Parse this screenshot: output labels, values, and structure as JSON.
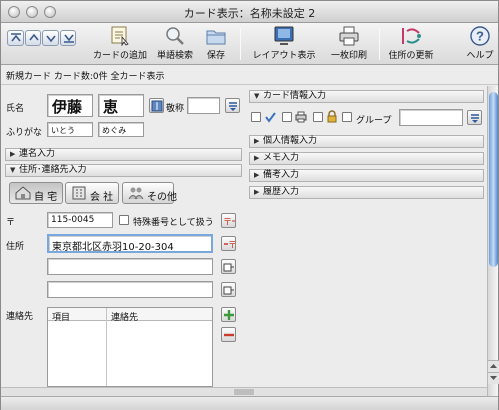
{
  "window": {
    "title": "カード表示：名称未設定 2"
  },
  "toolbar": {
    "add_card": "カードの追加",
    "word_search": "単語検索",
    "save": "保存",
    "layout": "レイアウト表示",
    "print": "一枚印刷",
    "update_address": "住所の更新",
    "help": "ヘルプ"
  },
  "infobar": {
    "text": "新規カード カード数:0件 全カード表示"
  },
  "name": {
    "label": "氏名",
    "family": "伊藤",
    "given": "恵",
    "honorific_label": "敬称",
    "honorific_value": ""
  },
  "furigana": {
    "label": "ふりがな",
    "family": "いとう",
    "given": "めぐみ"
  },
  "sections_left": {
    "joint_name": "連名入力",
    "address": "住所･連絡先入力"
  },
  "address_tabs": {
    "home": "自 宅",
    "work": "会 社",
    "other": "その他"
  },
  "postal": {
    "symbol": "〒",
    "value": "115-0045",
    "special_label": "特殊番号として扱う"
  },
  "address": {
    "label": "住所",
    "line1": "東京都北区赤羽10-20-304",
    "line2": "",
    "line3": ""
  },
  "contacts": {
    "label": "連絡先",
    "col_item": "項目",
    "col_contact": "連絡先"
  },
  "right": {
    "card_info": "カード情報入力",
    "group_label": "グループ",
    "group_value": "",
    "personal": "個人情報入力",
    "memo": "メモ入力",
    "notes": "備考入力",
    "history": "履歴入力"
  },
  "colors": {
    "accent": "#3a74c6",
    "focus": "#7aa7de",
    "red": "#c83a2a",
    "green": "#3c9a3c"
  }
}
